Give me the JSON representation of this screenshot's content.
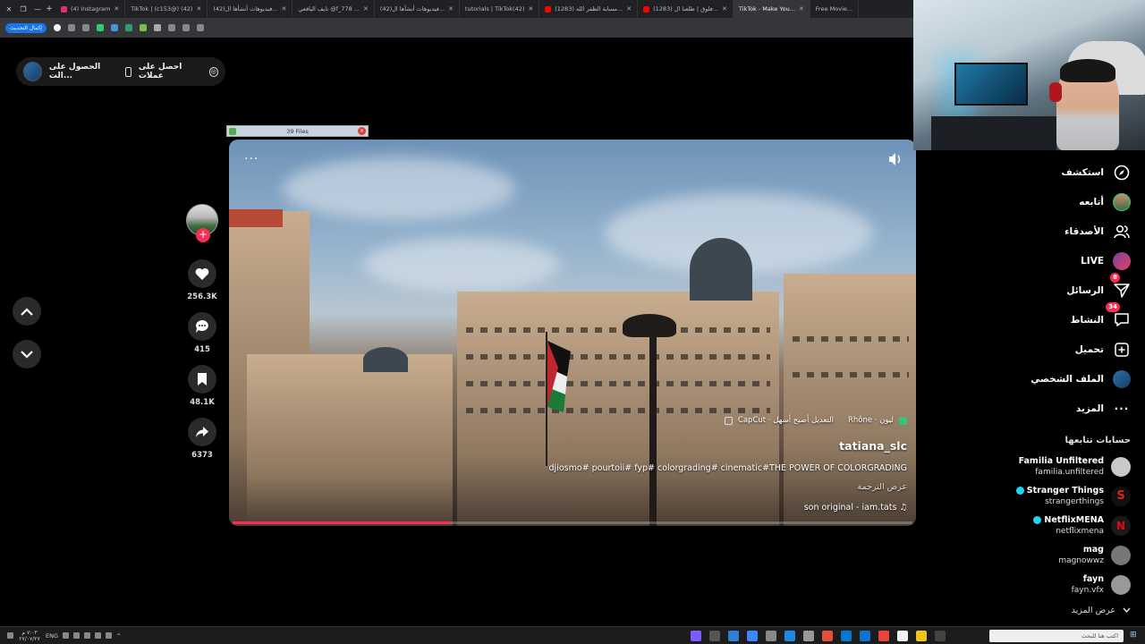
{
  "browser": {
    "tabs": [
      {
        "label": "(4) Instagram",
        "color": "#e1306c"
      },
      {
        "label": "TikTok | (c153@) (42)",
        "color": "#111"
      },
      {
        "label": "(42)فيديوهات أنشأها ال...",
        "color": "#111"
      },
      {
        "label": "نايف اليافعي @f_778 ...",
        "color": "#111"
      },
      {
        "label": "(42)فيديوهات أنشأها ال...",
        "color": "#111"
      },
      {
        "label": "tutorials | TikTok(42)",
        "color": "#111"
      },
      {
        "label": "(1283) مسابة الظفر الله...",
        "color": "#ff0000"
      },
      {
        "label": "(1283) فلوق | طلعنا ال...",
        "color": "#ff0000"
      },
      {
        "label": "TikTok - Make You...",
        "color": "#111",
        "active": true
      },
      {
        "label": "Free Movie...",
        "color": "#111"
      }
    ],
    "update_label": "إكمال التحديث"
  },
  "header": {
    "get_coins": "احصل على عملات",
    "get_app": "الحصول على الت..."
  },
  "files_bar": {
    "label": "39 Files"
  },
  "video": {
    "location": "Rhône · ليون",
    "capcut": "CapCut · التعديل أصبح أسهل",
    "author": "tatiana_slc",
    "caption": "djiosmo# pourtoii# fyp# colorgrading# cinematic#THE POWER OF COLORGRADING",
    "see_translation": "عرض الترجمة",
    "music": "son original - iam.tats",
    "progress_fraction": 0.32,
    "accent": "#fe2c55"
  },
  "actions": {
    "likes": "256.3K",
    "comments": "415",
    "saves": "48.1K",
    "shares": "6373"
  },
  "sidebar": {
    "items": [
      {
        "label": "استكشف",
        "icon": "compass-icon"
      },
      {
        "label": "أتابعه",
        "icon": "following-avatar"
      },
      {
        "label": "الأصدقاء",
        "icon": "friends-icon"
      },
      {
        "label": "LIVE",
        "icon": "live-avatar"
      },
      {
        "label": "الرسائل",
        "icon": "messages-icon",
        "badge": "8"
      },
      {
        "label": "النشاط",
        "icon": "activity-icon",
        "badge": "34"
      },
      {
        "label": "تحميل",
        "icon": "upload-icon"
      },
      {
        "label": "الملف الشخصي",
        "icon": "profile-avatar"
      },
      {
        "label": "المزيد",
        "icon": "more-icon"
      }
    ],
    "following_heading": "حسابات تتابعها",
    "following": [
      {
        "name": "Familia Unfiltered",
        "user": "familia.unfiltered",
        "verified": false,
        "color": "#c9c9c9"
      },
      {
        "name": "Stranger Things",
        "user": "strangerthings",
        "verified": true,
        "color": "#b01c1c"
      },
      {
        "name": "NetflixMENA",
        "user": "netflixmena",
        "verified": true,
        "color": "#1a1a1a"
      },
      {
        "name": "mag",
        "user": "magnowwz",
        "verified": false,
        "color": "#777"
      },
      {
        "name": "fayn",
        "user": "fayn.vfx",
        "verified": false,
        "color": "#999"
      }
    ],
    "see_more": "عرض المزيد"
  },
  "taskbar": {
    "lang": "ENG",
    "time": "٧:٠٣ م",
    "date": "٢٧/٠٧/٢٧",
    "search_placeholder": "اكتب هنا للبحث"
  }
}
